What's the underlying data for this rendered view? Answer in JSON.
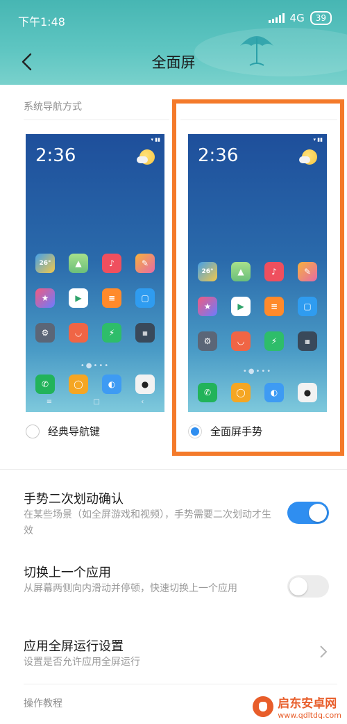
{
  "status_bar": {
    "time": "下午1:48",
    "network": "4G",
    "battery": "39"
  },
  "header": {
    "title": "全面屏"
  },
  "nav_style": {
    "section_label": "系统导航方式",
    "options": [
      {
        "preview_clock": "2:36",
        "label": "经典导航键",
        "selected": false
      },
      {
        "preview_clock": "2:36",
        "label": "全面屏手势",
        "selected": true
      }
    ],
    "highlight_color": "#F47A2A",
    "weather_label": "26°"
  },
  "settings": [
    {
      "title": "手势二次划动确认",
      "description": "在某些场景（如全屏游戏和视频），手势需要二次划动才生效",
      "control": "toggle",
      "enabled": true
    },
    {
      "title": "切换上一个应用",
      "description": "从屏幕两侧向内滑动并停顿，快速切换上一个应用",
      "control": "toggle",
      "enabled": false
    },
    {
      "title": "应用全屏运行设置",
      "description": "设置是否允许应用全屏运行",
      "control": "chevron"
    }
  ],
  "tutorial": {
    "label": "操作教程"
  },
  "watermark": {
    "name": "启东安卓网",
    "url": "www.qdltdq.com"
  },
  "colors": {
    "header_teal": "#5CC3BF",
    "accent_blue": "#2F8EF0",
    "highlight_orange": "#F47A2A"
  }
}
